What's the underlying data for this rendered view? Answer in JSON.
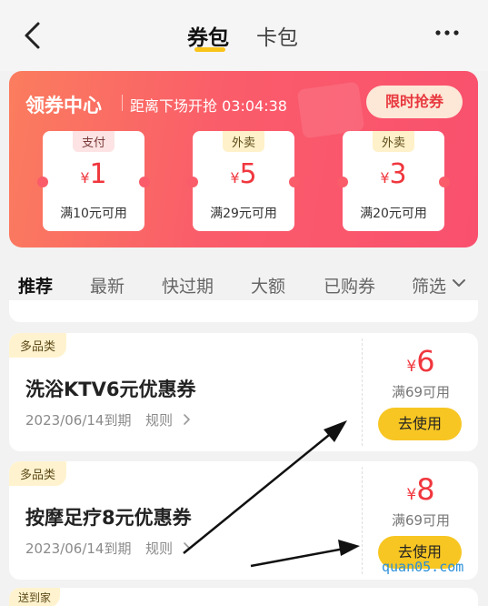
{
  "header": {
    "tab_active": "券包",
    "tab_inactive": "卡包"
  },
  "banner": {
    "title": "领券中心",
    "countdown_text": "距离下场开抢 03:04:38",
    "cta_label": "限时抢券",
    "coupons": [
      {
        "tag": "支付",
        "symbol": "¥",
        "amount": "1",
        "condition": "满10元可用"
      },
      {
        "tag": "外卖",
        "symbol": "¥",
        "amount": "5",
        "condition": "满29元可用"
      },
      {
        "tag": "外卖",
        "symbol": "¥",
        "amount": "3",
        "condition": "满20元可用"
      }
    ]
  },
  "filters": [
    "推荐",
    "最新",
    "快过期",
    "大额",
    "已购券",
    "筛选"
  ],
  "coupons": [
    {
      "tag": "多品类",
      "title": "洗浴KTV6元优惠券",
      "expiry": "2023/06/14到期",
      "rule_label": "规则",
      "symbol": "¥",
      "amount": "6",
      "condition": "满69可用",
      "button_label": "去使用"
    },
    {
      "tag": "多品类",
      "title": "按摩足疗8元优惠券",
      "expiry": "2023/06/14到期",
      "rule_label": "规则",
      "symbol": "¥",
      "amount": "8",
      "condition": "满69可用",
      "button_label": "去使用"
    }
  ],
  "partial_card_tag": "送到家",
  "watermark": "quan05.com",
  "colors": {
    "accent_yellow": "#f7c623",
    "price_red": "#f0373e",
    "banner_red": "#fa5c6a"
  }
}
